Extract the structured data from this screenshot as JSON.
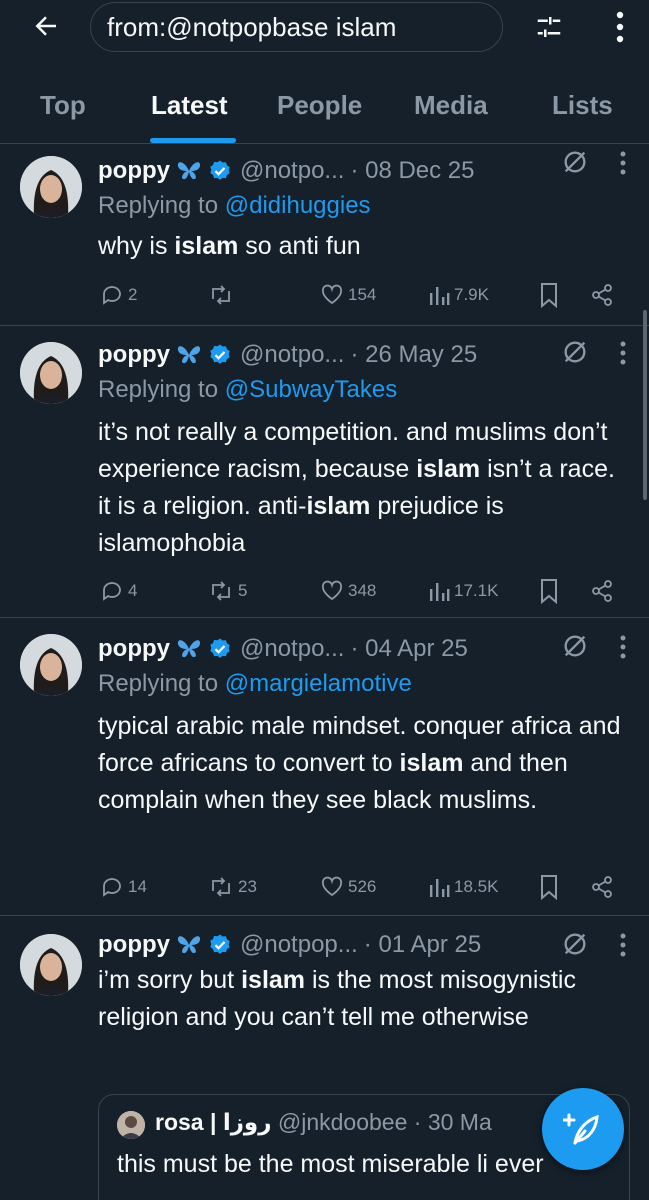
{
  "search": {
    "query": "from:@notpopbase islam"
  },
  "tabs": [
    {
      "label": "Top"
    },
    {
      "label": "Latest"
    },
    {
      "label": "People"
    },
    {
      "label": "Media"
    },
    {
      "label": "Lists"
    }
  ],
  "colors": {
    "background": "#15202b",
    "accent": "#1d9bf0",
    "muted": "#8b98a5",
    "divider": "#38444d"
  },
  "tweets": [
    {
      "name": "poppy",
      "handle": "@notpo...",
      "date": "· 08 Dec 25",
      "replying_prefix": "Replying to ",
      "replying_to": "@didihuggies",
      "body": [
        {
          "t": "why is "
        },
        {
          "t": "islam",
          "b": true
        },
        {
          "t": " so anti fun"
        }
      ],
      "replies": "2",
      "reposts": "",
      "likes": "154",
      "views": "7.9K"
    },
    {
      "name": "poppy",
      "handle": "@notpo...",
      "date": "· 26 May 25",
      "replying_prefix": "Replying to ",
      "replying_to": "@SubwayTakes",
      "body": [
        {
          "t": "it’s not really a competition. and muslims don’t experience racism, because "
        },
        {
          "t": "islam",
          "b": true
        },
        {
          "t": " isn’t a race. it is a religion. anti-"
        },
        {
          "t": "islam",
          "b": true
        },
        {
          "t": " prejudice is islamophobia"
        }
      ],
      "replies": "4",
      "reposts": "5",
      "likes": "348",
      "views": "17.1K"
    },
    {
      "name": "poppy",
      "handle": "@notpo...",
      "date": "· 04 Apr 25",
      "replying_prefix": "Replying to ",
      "replying_to": "@margielamotive",
      "body": [
        {
          "t": "typical arabic male mindset. conquer africa and force africans to convert to "
        },
        {
          "t": "islam",
          "b": true
        },
        {
          "t": " and then complain when they see black muslims."
        }
      ],
      "replies": "14",
      "reposts": "23",
      "likes": "526",
      "views": "18.5K"
    },
    {
      "name": "poppy",
      "handle": "@notpop...",
      "date": "· 01 Apr 25",
      "body": [
        {
          "t": "i’m sorry but "
        },
        {
          "t": "islam",
          "b": true
        },
        {
          "t": " is the most misogynistic religion  and you can’t tell me otherwise"
        }
      ],
      "quote": {
        "name": "rosa | روزا",
        "handle": "@jnkdoobee · 30 Ma",
        "body": "this must be the most miserable li ever"
      }
    }
  ]
}
